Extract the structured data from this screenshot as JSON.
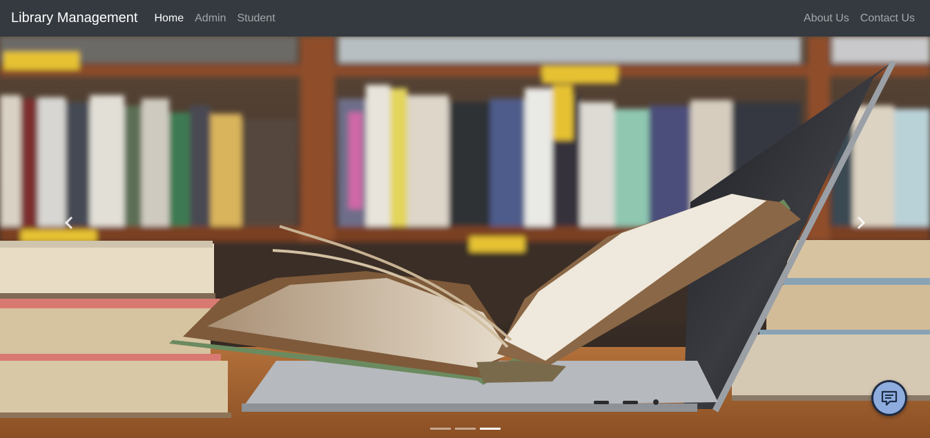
{
  "navbar": {
    "brand": "Library Management",
    "left_links": [
      {
        "label": "Home",
        "active": true
      },
      {
        "label": "Admin",
        "active": false
      },
      {
        "label": "Student",
        "active": false
      }
    ],
    "right_links": [
      {
        "label": "About Us"
      },
      {
        "label": "Contact Us"
      }
    ]
  },
  "carousel": {
    "slide_count": 3,
    "active_index": 2,
    "prev_icon": "chevron-left-icon",
    "next_icon": "chevron-right-icon"
  },
  "chat": {
    "icon": "chat-icon"
  },
  "colors": {
    "navbar_bg": "#343a40",
    "chat_button": "#8eacde"
  }
}
